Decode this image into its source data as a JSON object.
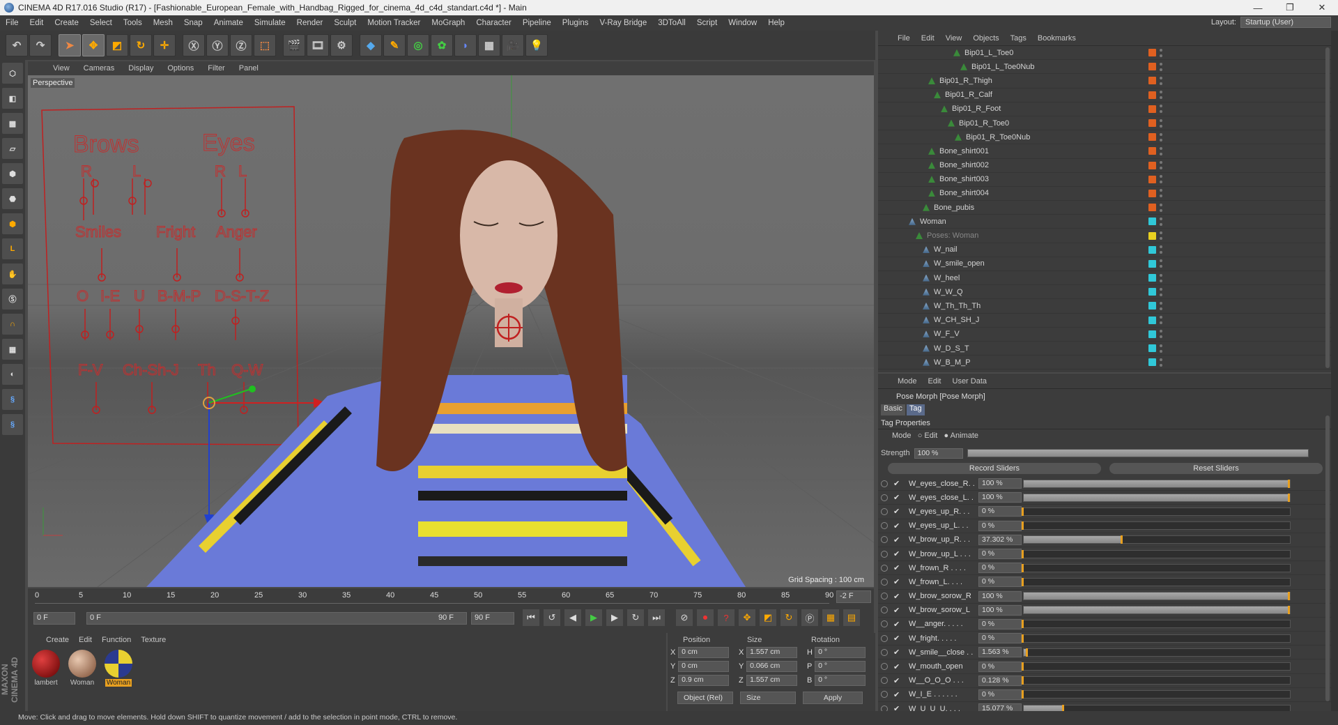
{
  "window": {
    "title": "CINEMA 4D R17.016 Studio (R17) - [Fashionable_European_Female_with_Handbag_Rigged_for_cinema_4d_c4d_standart.c4d *] - Main",
    "controls": [
      "—",
      "❐",
      "✕"
    ]
  },
  "menu": [
    "File",
    "Edit",
    "Create",
    "Select",
    "Tools",
    "Mesh",
    "Snap",
    "Animate",
    "Simulate",
    "Render",
    "Sculpt",
    "Motion Tracker",
    "MoGraph",
    "Character",
    "Pipeline",
    "Plugins",
    "V-Ray Bridge",
    "3DToAll",
    "Script",
    "Window",
    "Help"
  ],
  "layout": {
    "label": "Layout:",
    "value": "Startup (User)"
  },
  "viewport": {
    "menu": [
      "View",
      "Cameras",
      "Display",
      "Options",
      "Filter",
      "Panel"
    ],
    "label": "Perspective",
    "grid_spacing": "Grid Spacing : 100 cm",
    "face_rig_labels": {
      "brows": "Brows",
      "eyes": "Eyes",
      "r1": "R",
      "l1": "L",
      "r2": "R",
      "l2": "L",
      "smiles": "Smiles",
      "fright": "Fright",
      "anger": "Anger",
      "o": "O",
      "ie": "I-E",
      "u": "U",
      "bmp": "B-M-P",
      "dstz": "D-S-T-Z",
      "fv": "F-V",
      "chshj": "Ch-Sh-J",
      "th": "Th",
      "qw": "Q-W"
    }
  },
  "timeline": {
    "ticks": [
      "0",
      "5",
      "10",
      "15",
      "20",
      "25",
      "30",
      "35",
      "40",
      "45",
      "50",
      "55",
      "60",
      "65",
      "70",
      "75",
      "80",
      "85",
      "90"
    ],
    "current_frame_right": "-2 F",
    "start": "0 F",
    "slider_start": "0 F",
    "slider_end": "90 F",
    "end": "90 F"
  },
  "materials": {
    "menu": [
      "Create",
      "Edit",
      "Function",
      "Texture"
    ],
    "items": [
      {
        "name": "lambert"
      },
      {
        "name": "Woman"
      },
      {
        "name": "Woman"
      }
    ]
  },
  "coords": {
    "headers": [
      "Position",
      "Size",
      "Rotation"
    ],
    "rows": [
      {
        "a": "X",
        "pos": "0 cm",
        "b": "X",
        "size": "1.557 cm",
        "c": "H",
        "rot": "0 °"
      },
      {
        "a": "Y",
        "pos": "0 cm",
        "b": "Y",
        "size": "0.066 cm",
        "c": "P",
        "rot": "0 °"
      },
      {
        "a": "Z",
        "pos": "0.9 cm",
        "b": "Z",
        "size": "1.557 cm",
        "c": "B",
        "rot": "0 °"
      }
    ],
    "mode": "Object (Rel)",
    "size_mode": "Size",
    "apply": "Apply"
  },
  "objects": {
    "menu": [
      "File",
      "Edit",
      "View",
      "Objects",
      "Tags",
      "Bookmarks"
    ],
    "rows": [
      {
        "name": "Bip01_L_Toe0",
        "color": "#e06020"
      },
      {
        "name": "Bip01_L_Toe0Nub",
        "color": "#e06020"
      },
      {
        "name": "Bip01_R_Thigh",
        "color": "#e06020"
      },
      {
        "name": "Bip01_R_Calf",
        "color": "#e06020"
      },
      {
        "name": "Bip01_R_Foot",
        "color": "#e06020"
      },
      {
        "name": "Bip01_R_Toe0",
        "color": "#e06020"
      },
      {
        "name": "Bip01_R_Toe0Nub",
        "color": "#e06020"
      },
      {
        "name": "Bone_shirt001",
        "color": "#e06020"
      },
      {
        "name": "Bone_shirt002",
        "color": "#e06020"
      },
      {
        "name": "Bone_shirt003",
        "color": "#e06020"
      },
      {
        "name": "Bone_shirt004",
        "color": "#e06020"
      },
      {
        "name": "Bone_pubis",
        "color": "#e06020"
      },
      {
        "name": "Woman",
        "color": "#30c8d8"
      },
      {
        "name": "Poses: Woman",
        "color": "#e8d020"
      },
      {
        "name": "W_nail",
        "color": "#30c8d8"
      },
      {
        "name": "W_smile_open",
        "color": "#30c8d8"
      },
      {
        "name": "W_heel",
        "color": "#30c8d8"
      },
      {
        "name": "W_W_Q",
        "color": "#30c8d8"
      },
      {
        "name": "W_Th_Th_Th",
        "color": "#30c8d8"
      },
      {
        "name": "W_CH_SH_J",
        "color": "#30c8d8"
      },
      {
        "name": "W_F_V",
        "color": "#30c8d8"
      },
      {
        "name": "W_D_S_T",
        "color": "#30c8d8"
      },
      {
        "name": "W_B_M_P",
        "color": "#30c8d8"
      }
    ]
  },
  "attributes": {
    "menu": [
      "Mode",
      "Edit",
      "User Data"
    ],
    "title": "Pose Morph [Pose Morph]",
    "tabs": [
      "Basic",
      "Tag"
    ],
    "section": "Tag Properties",
    "mode_label": "Mode",
    "mode_edit": "Edit",
    "mode_animate": "Animate",
    "strength_label": "Strength",
    "strength_value": "100 %",
    "record": "Record Sliders",
    "reset": "Reset Sliders",
    "sliders": [
      {
        "name": "W_eyes_close_R. .",
        "value": "100 %",
        "frac": 1.0
      },
      {
        "name": "W_eyes_close_L. .",
        "value": "100 %",
        "frac": 1.0
      },
      {
        "name": "W_eyes_up_R. . .",
        "value": "0 %",
        "frac": 0.0
      },
      {
        "name": "W_eyes_up_L. . .",
        "value": "0 %",
        "frac": 0.0
      },
      {
        "name": "W_brow_up_R. . .",
        "value": "37.302 %",
        "frac": 0.373
      },
      {
        "name": "W_brow_up_L . . .",
        "value": "0 %",
        "frac": 0.0
      },
      {
        "name": "W_frown_R . . . .",
        "value": "0 %",
        "frac": 0.0
      },
      {
        "name": "W_frown_L. . . .",
        "value": "0 %",
        "frac": 0.0
      },
      {
        "name": "W_brow_sorow_R",
        "value": "100 %",
        "frac": 1.0
      },
      {
        "name": "W_brow_sorow_L",
        "value": "100 %",
        "frac": 1.0
      },
      {
        "name": "W__anger. . . . .",
        "value": "0 %",
        "frac": 0.0
      },
      {
        "name": "W_fright. . . . .",
        "value": "0 %",
        "frac": 0.0
      },
      {
        "name": "W_smile__close . .",
        "value": "1.563 %",
        "frac": 0.016
      },
      {
        "name": "W_mouth_open",
        "value": "0 %",
        "frac": 0.0
      },
      {
        "name": "W__O_O_O . . .",
        "value": "0.128 %",
        "frac": 0.001
      },
      {
        "name": "W_I_E . . . . . .",
        "value": "0 %",
        "frac": 0.0
      },
      {
        "name": "W_U_U_U. . . .",
        "value": "15.077 %",
        "frac": 0.151
      }
    ]
  },
  "status": "Move: Click and drag to move elements. Hold down SHIFT to quantize movement / add to the selection in point mode, CTRL to remove.",
  "maxon": "MAXON CINEMA 4D"
}
